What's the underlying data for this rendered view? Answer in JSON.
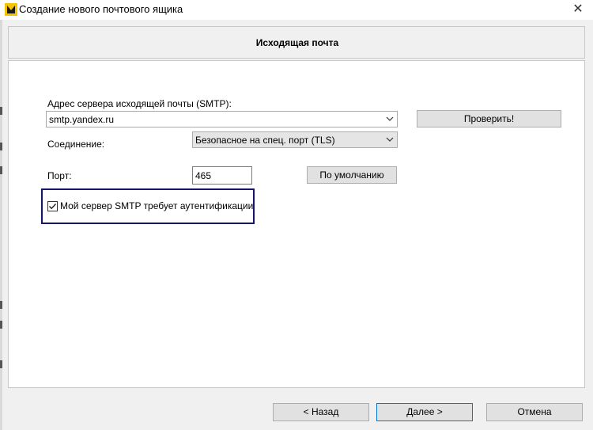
{
  "window": {
    "title": "Создание нового почтового ящика",
    "close_glyph": "✕"
  },
  "header": {
    "title": "Исходящая почта"
  },
  "form": {
    "server_label": "Адрес сервера исходящей почты (SMTP):",
    "server_value": "smtp.yandex.ru",
    "check_button": "Проверить!",
    "connection_label": "Соединение:",
    "connection_value": "Безопасное на спец. порт (TLS)",
    "port_label": "Порт:",
    "port_value": "465",
    "default_button": "По умолчанию",
    "auth_checkbox_label": "Мой сервер SMTP требует аутентификации",
    "auth_checked": true
  },
  "footer": {
    "back_button": "<  Назад",
    "next_button": "Далее  >",
    "cancel_button": "Отмена"
  },
  "icons": {
    "app": "app-logo-icon",
    "close": "close-icon",
    "dropdown": "chevron-down-icon",
    "check": "checkmark-icon"
  },
  "colors": {
    "focus_border": "#15166b",
    "default_button_border": "#0078d7",
    "panel_bg": "#ffffff",
    "window_bg": "#f0f0f0"
  }
}
